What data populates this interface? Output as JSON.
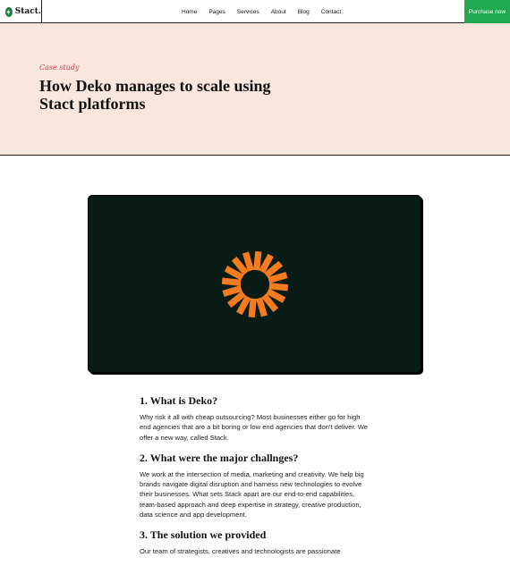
{
  "header": {
    "brand": "Stact.",
    "nav": [
      "Home",
      "Pages",
      "Services",
      "About",
      "Blog",
      "Contact"
    ],
    "cta": "Purchase now"
  },
  "hero": {
    "kicker": "Case study",
    "title": "How Deko manages to scale using Stact platforms"
  },
  "media": {
    "logo_icon": "sunburst-logo-icon",
    "colors": {
      "background": "#0a1c15",
      "accent": "#f47b20"
    }
  },
  "article": {
    "sections": [
      {
        "heading": "1. What is Deko?",
        "body": "Why risk it all with cheap outsourcing? Most businesses either go for high end agencies that are a bit boring or low end agencies that don't deliver. We offer a new way, called Stack."
      },
      {
        "heading": "2. What were the major challnges?",
        "body": "We work at the intersection of media, marketing and creativity. We help big brands navigate digital disruption and harness new technologies to evolve their businesses. What sets Stack apart are our end-to-end capabilities, team-based approach and deep expertise in strategy, creative production, data science and app development."
      },
      {
        "heading": "3. The solution we provided",
        "body": "Our team of strategists, creatives and technologists are passionate"
      }
    ]
  },
  "colors": {
    "hero_bg": "#f9e6dd",
    "cta_bg": "#1fa84f",
    "kicker": "#d8364a"
  }
}
